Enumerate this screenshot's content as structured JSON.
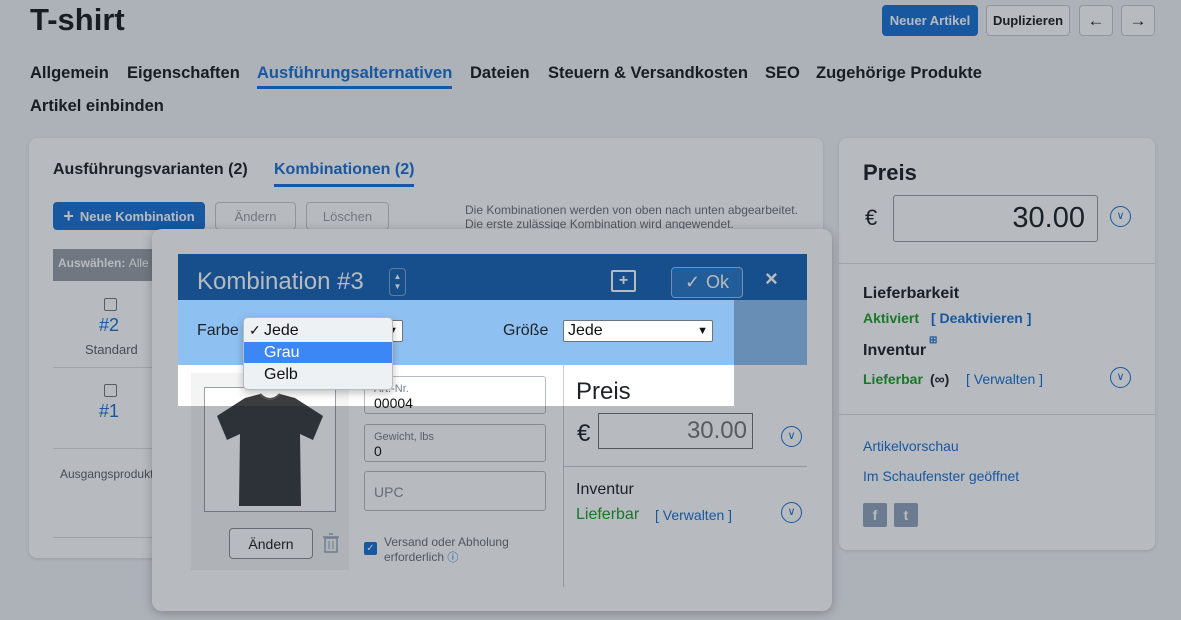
{
  "page": {
    "title": "T-shirt",
    "new_article": "Neuer Artikel",
    "duplicate": "Duplizieren",
    "prev_icon": "arrow-left-icon",
    "next_icon": "arrow-right-icon"
  },
  "tabs": [
    "Allgemein",
    "Eigenschaften",
    "Ausführungsalternativen",
    "Dateien",
    "Steuern & Versandkosten",
    "SEO",
    "Zugehörige Produkte",
    "Artikel einbinden"
  ],
  "left_card": {
    "subtab_variants": "Ausführungsvarianten (2)",
    "subtab_combinations": "Kombinationen (2)",
    "new_combination": "Neue Kombination",
    "edit": "Ändern",
    "delete": "Löschen",
    "hint_line1": "Die Kombinationen werden von oben nach unten abgearbeitet.",
    "hint_line2": "Die erste zulässige Kombination wird angewendet.",
    "select_label": "Auswählen:",
    "select_all": "Alle",
    "rows": [
      {
        "id": "#2",
        "sub": "Standard"
      },
      {
        "id": "#1",
        "sub": ""
      }
    ],
    "base_product": "Ausgangsprodukt"
  },
  "right_card": {
    "price_title": "Preis",
    "currency": "€",
    "price": "30.00",
    "availability_title": "Lieferbarkeit",
    "active": "Aktiviert",
    "deactivate": "[ Deaktivieren ]",
    "inventory_title": "Inventur",
    "inventory_status": "Lieferbar",
    "inventory_infinite": "(∞)",
    "manage": "[ Verwalten ]",
    "preview": "Artikelvorschau",
    "storefront": "Im Schaufenster geöffnet"
  },
  "modal": {
    "title": "Kombination #3",
    "ok": "Ok",
    "color_label": "Farbe",
    "size_label": "Größe",
    "size_value": "Jede",
    "sku_label": "Art.-Nr.",
    "sku_value": "00004",
    "weight_label": "Gewicht, lbs",
    "weight_value": "0",
    "upc_placeholder": "UPC",
    "change_image": "Ändern",
    "shipping_line1": "Versand oder Abholung",
    "shipping_line2": "erforderlich",
    "price_title": "Preis",
    "currency": "€",
    "price": "30.00",
    "inventory_title": "Inventur",
    "inventory_status": "Lieferbar",
    "manage": "[ Verwalten ]"
  },
  "color_dropdown": {
    "options": [
      "Jede",
      "Grau",
      "Gelb"
    ],
    "checked": "Jede",
    "highlighted": "Grau"
  },
  "colors": {
    "accent": "#1b73d4",
    "modal_header": "#1a66b8",
    "filter_bar": "#8ec0f2",
    "green": "#1e9f2c"
  }
}
